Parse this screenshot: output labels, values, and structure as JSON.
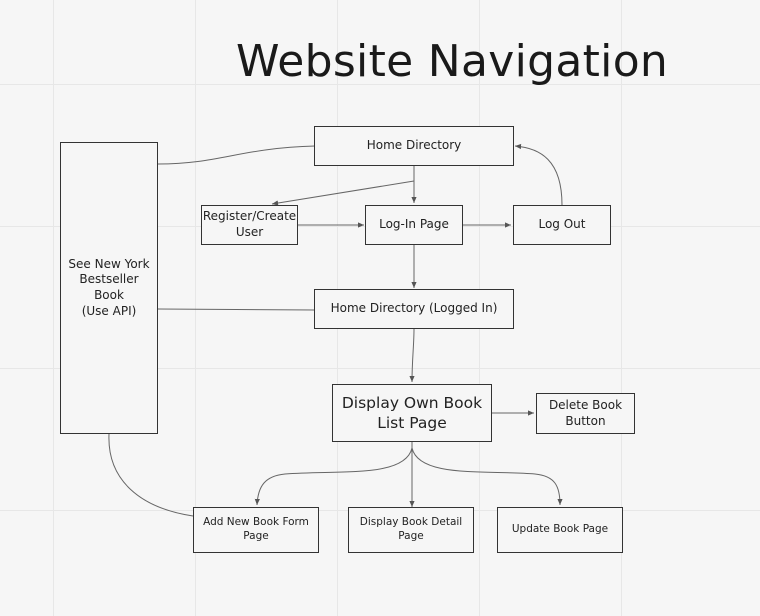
{
  "title": "Website Navigation",
  "nodes": {
    "home_directory": "Home Directory",
    "register_create_user": "Register/Create\nUser",
    "log_in_page": "Log-In Page",
    "log_out": "Log Out",
    "see_ny_bestseller": "See New York\nBestseller\nBook\n(Use API)",
    "home_directory_logged_in": "Home Directory (Logged In)",
    "display_own_book_list": "Display Own Book\nList Page",
    "delete_book_button": "Delete Book\nButton",
    "add_new_book_form": "Add New Book Form\nPage",
    "display_book_detail": "Display Book Detail Page",
    "update_book_page": "Update Book Page"
  },
  "colors": {
    "background": "#f6f6f6",
    "grid": "#e7e7e7",
    "stroke": "#333333",
    "connector": "#555555",
    "text": "#222222"
  }
}
